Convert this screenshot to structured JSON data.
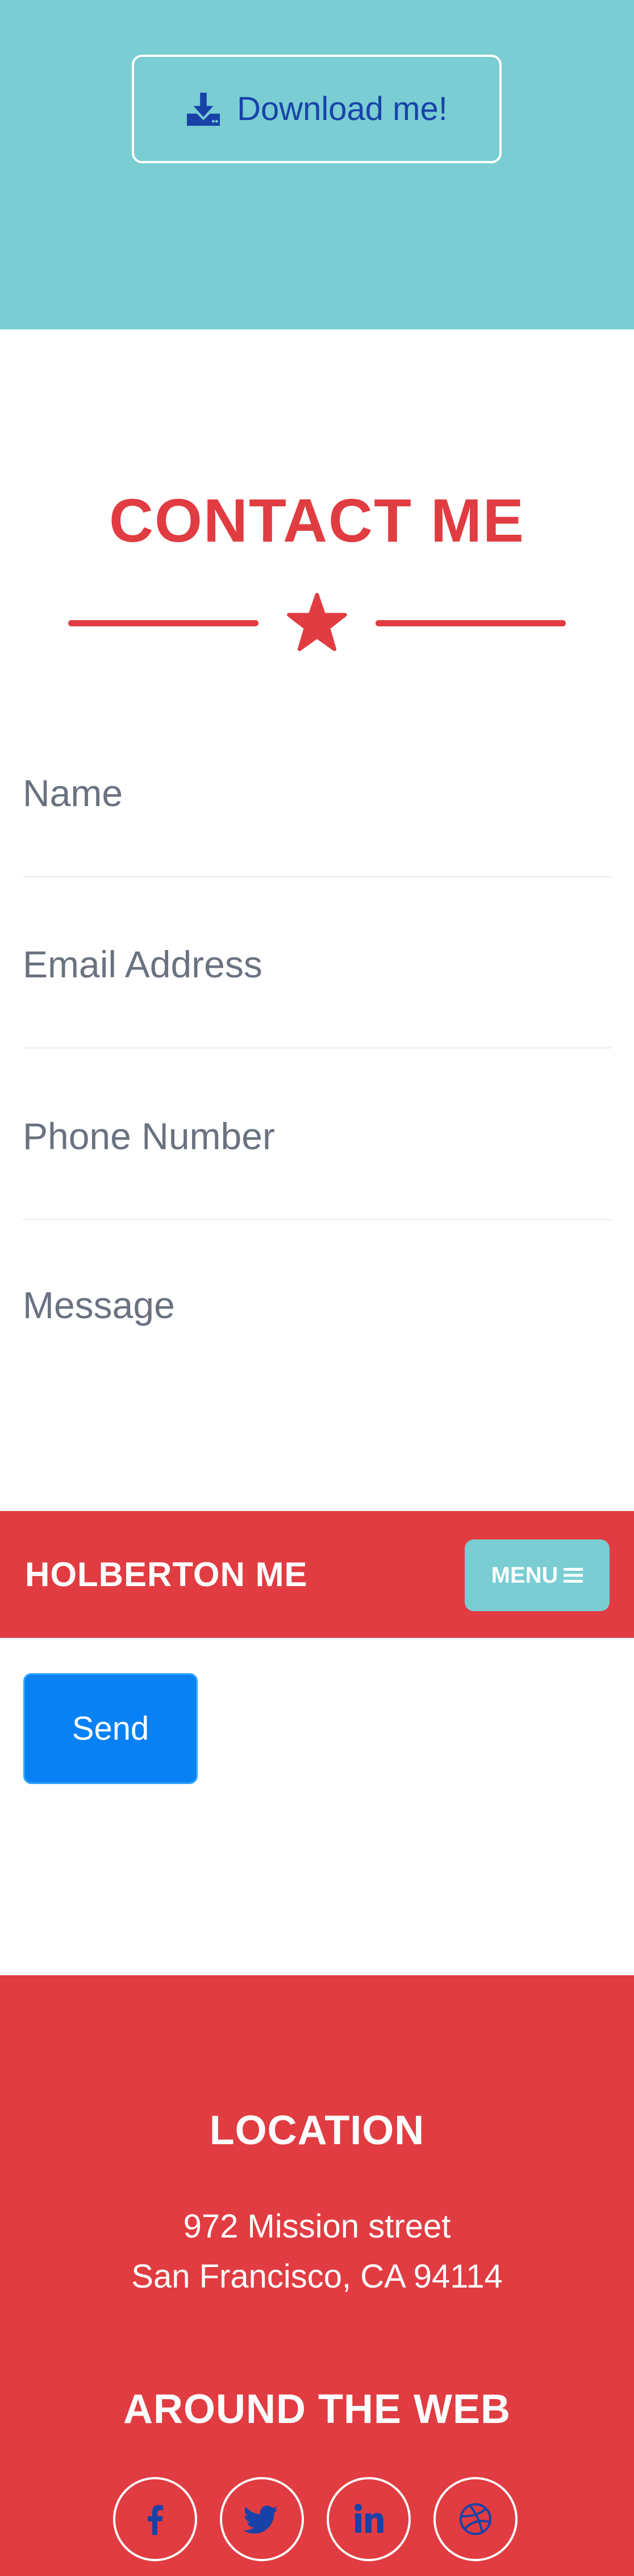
{
  "download": {
    "label": "Download me!",
    "icon": "download-icon"
  },
  "contact": {
    "title": "CONTACT ME",
    "fields": {
      "name": "Name",
      "email": "Email Address",
      "phone": "Phone Number",
      "message": "Message"
    },
    "send_label": "Send"
  },
  "navbar": {
    "brand": "HOLBERTON ME",
    "menu_label": "MENU"
  },
  "footer": {
    "location_heading": "LOCATION",
    "address_line1": "972 Mission street",
    "address_line2": "San Francisco, CA 94114",
    "web_heading": "AROUND THE WEB",
    "social_icons": [
      "facebook-icon",
      "twitter-icon",
      "linkedin-icon",
      "dribbble-icon"
    ]
  },
  "colors": {
    "teal": "#79cdd3",
    "red": "#e03c41",
    "blue_text": "#1842a8",
    "send_blue": "#0781f4",
    "field_text": "#6a7280"
  }
}
